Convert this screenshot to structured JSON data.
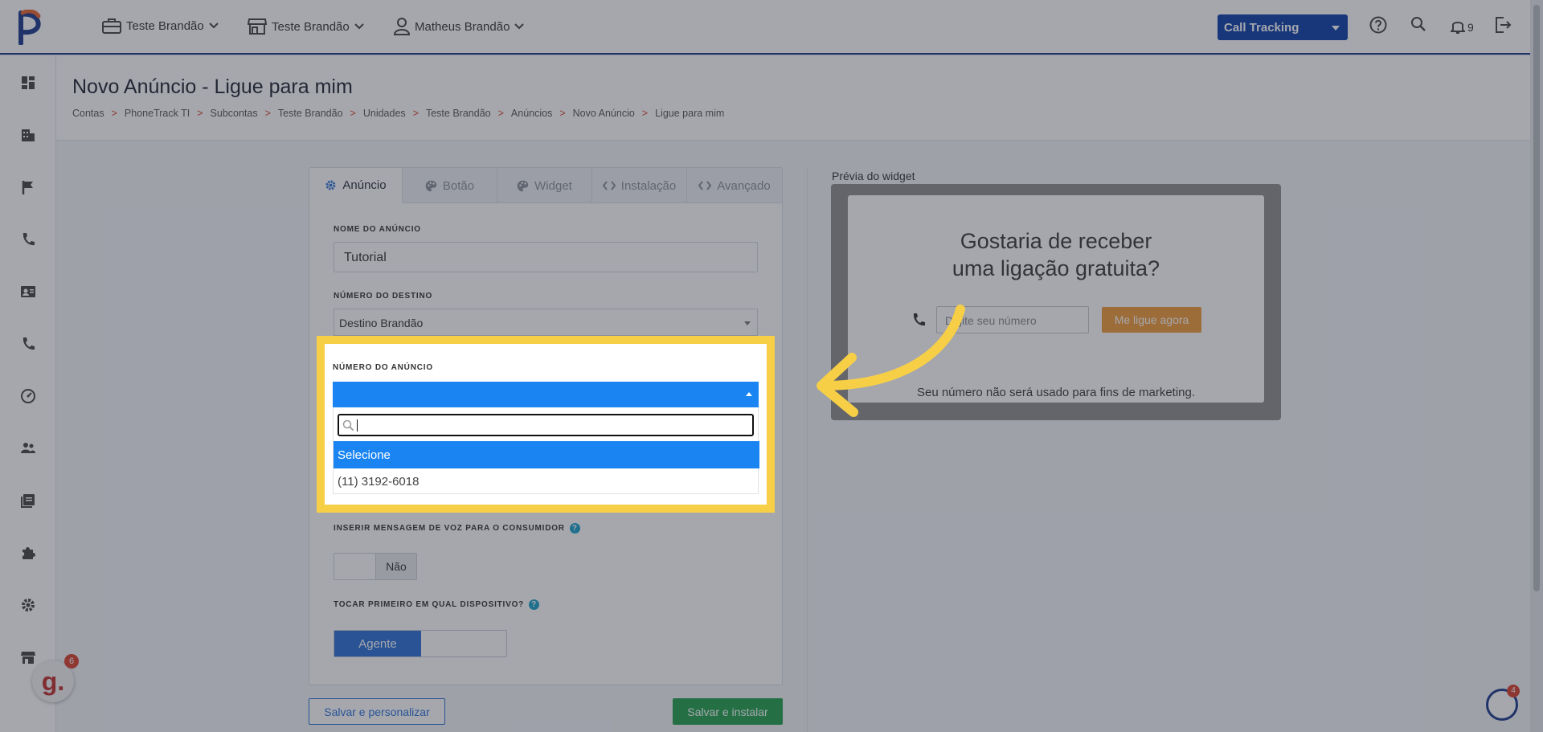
{
  "topbar": {
    "menu1": "Teste Brandão",
    "menu2": "Teste Brandão",
    "menu3": "Matheus Brandão",
    "product_select": "Call Tracking",
    "notification_count": "9"
  },
  "page": {
    "title": "Novo Anúncio - Ligue para mim",
    "breadcrumb": [
      "Contas",
      "PhoneTrack TI",
      "Subcontas",
      "Teste Brandão",
      "Unidades",
      "Teste Brandão",
      "Anúncios",
      "Novo Anúncio",
      "Ligue para mim"
    ],
    "breadcrumb_sep": ">"
  },
  "tabs": [
    {
      "label": "Anúncio",
      "icon": "gear-icon",
      "active": true
    },
    {
      "label": "Botão",
      "icon": "palette-icon",
      "active": false
    },
    {
      "label": "Widget",
      "icon": "palette-icon",
      "active": false
    },
    {
      "label": "Instalação",
      "icon": "code-icon",
      "active": false
    },
    {
      "label": "Avançado",
      "icon": "code-icon",
      "active": false
    }
  ],
  "form": {
    "name_label": "NOME DO ANÚNCIO",
    "name_value": "Tutorial",
    "dest_label": "NÚMERO DO DESTINO",
    "dest_value": "Destino Brandão",
    "ad_number_label": "NÚMERO DO ANÚNCIO",
    "voice_label": "INSERIR MENSAGEM DE VOZ PARA O CONSUMIDOR",
    "voice_toggle": "Não",
    "device_label": "TOCAR PRIMEIRO EM QUAL DISPOSITIVO?",
    "device_selected": "Agente",
    "help": "?"
  },
  "dropdown": {
    "options": [
      "Selecione",
      "(11) 3192-6018"
    ],
    "selected": "Selecione"
  },
  "buttons": {
    "save_customize": "Salvar e personalizar",
    "save_install": "Salvar e instalar"
  },
  "preview": {
    "label": "Prévia do widget",
    "title_line1": "Gostaria de receber",
    "title_line2": "uma ligação gratuita?",
    "input_placeholder": "Digite seu número",
    "call_button": "Me ligue agora",
    "note": "Seu número não será usado para fins de marketing."
  },
  "badges": {
    "g_letter": "g.",
    "g_count": "6",
    "chat_count": "4"
  },
  "colors": {
    "brand_blue": "#0d3ea8",
    "highlight": "#f7cf47",
    "accent_orange": "#f29b38",
    "success_green": "#22a04b",
    "select_blue": "#1a85f2"
  }
}
